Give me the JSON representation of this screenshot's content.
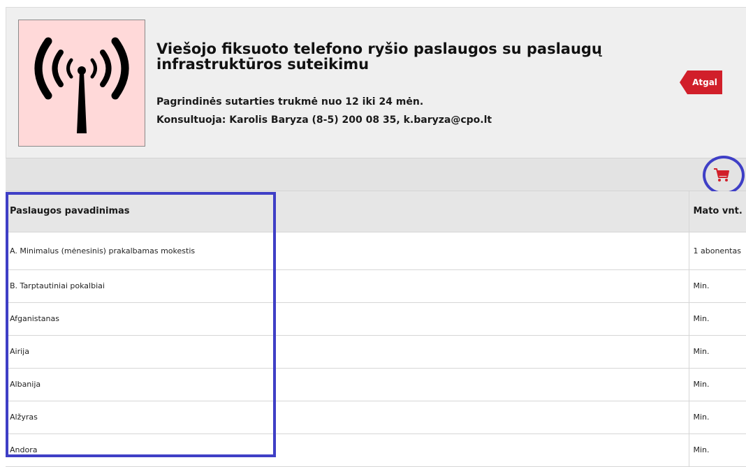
{
  "service": {
    "title": "Viešojo fiksuoto telefono ryšio paslaugos su paslaugų infrastruktūros suteikimu",
    "duration": "Pagrindinės sutarties trukmė nuo 12 iki 24 mėn.",
    "consultant": "Konsultuoja: Karolis Baryza (8-5) 200 08 35, k.baryza@cpo.lt",
    "icon": "antenna-broadcast-icon"
  },
  "actions": {
    "back_label": "Atgal",
    "cart_icon": "shopping-cart-icon"
  },
  "colors": {
    "accent_red": "#d11f2a",
    "highlight_blue": "#3f3fc6",
    "logo_background": "#ffd9d9"
  },
  "table": {
    "headers": {
      "name": "Paslaugos pavadinimas",
      "unit": "Mato vnt."
    },
    "rows": [
      {
        "name": "A. Minimalus (mėnesinis) prakalbamas mokestis",
        "unit": "1 abonentas"
      },
      {
        "name": "B. Tarptautiniai pokalbiai",
        "unit": "Min."
      },
      {
        "name": "Afganistanas",
        "unit": "Min."
      },
      {
        "name": "Airija",
        "unit": "Min."
      },
      {
        "name": "Albanija",
        "unit": "Min."
      },
      {
        "name": "Alžyras",
        "unit": "Min."
      },
      {
        "name": "Andora",
        "unit": "Min."
      }
    ]
  }
}
